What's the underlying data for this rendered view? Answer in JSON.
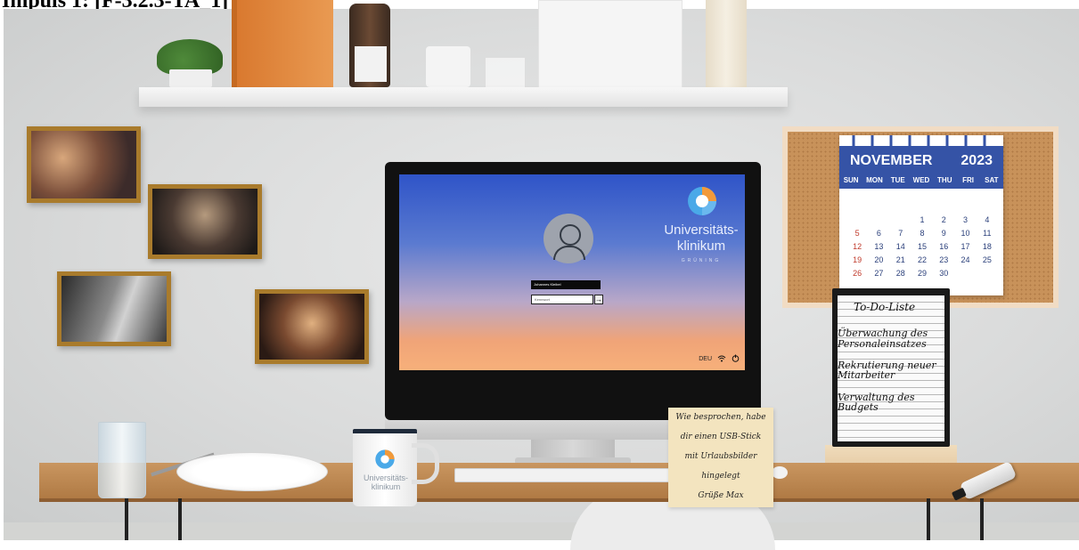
{
  "heading": "Impuls 1: [F-3.2.3-TA_1]",
  "login_screen": {
    "username": "Johannes Kleibel",
    "password_placeholder": "Kennwort",
    "submit_icon": "arrow-right-icon",
    "brand_line1": "Universitäts-",
    "brand_line2": "klinikum",
    "brand_line3": "GRÜNING",
    "tray": {
      "language": "DEU",
      "network_icon": "wifi-icon",
      "power_icon": "power-icon"
    }
  },
  "calendar": {
    "month": "NOVEMBER",
    "year": "2023",
    "weekdays": [
      "SUN",
      "MON",
      "TUE",
      "WED",
      "THU",
      "FRI",
      "SAT"
    ],
    "weeks": [
      [
        "",
        "",
        "",
        "1",
        "2",
        "3",
        "4"
      ],
      [
        "5",
        "6",
        "7",
        "8",
        "9",
        "10",
        "11"
      ],
      [
        "12",
        "13",
        "14",
        "15",
        "16",
        "17",
        "18"
      ],
      [
        "19",
        "20",
        "21",
        "22",
        "23",
        "24",
        "25"
      ],
      [
        "26",
        "27",
        "28",
        "29",
        "30",
        "",
        ""
      ]
    ]
  },
  "todo": {
    "title": "To-Do-Liste",
    "items": [
      [
        "Überwachung des",
        "Personaleinsatzes"
      ],
      [
        "Rekrutierung neuer",
        "Mitarbeiter"
      ],
      [
        "Verwaltung des",
        "Budgets"
      ]
    ]
  },
  "sticky_note": {
    "lines": [
      "Wie besprochen, habe",
      "dir einen USB-Stick",
      "mit Urlaubsbilder",
      "hingelegt",
      "Grüße Max"
    ]
  },
  "mug": {
    "line1": "Universitäts-",
    "line2": "klinikum"
  },
  "colors": {
    "calendar_header": "#3553a6",
    "sunday_red": "#c03a2b",
    "frame_gold": "#a97b2c"
  }
}
